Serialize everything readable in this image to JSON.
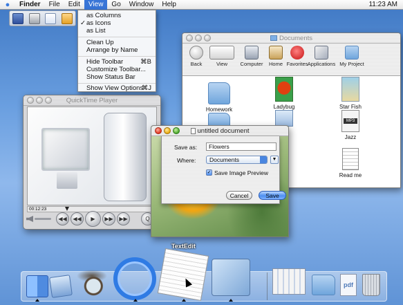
{
  "menubar": {
    "apple_icon": "apple-icon",
    "items": [
      "Finder",
      "File",
      "Edit",
      "View",
      "Go",
      "Window",
      "Help"
    ],
    "active": "View",
    "clock": "11:23 AM"
  },
  "view_menu": {
    "items": [
      {
        "label": "as Columns",
        "checked": false,
        "shortcut": ""
      },
      {
        "label": "as Icons",
        "checked": true,
        "shortcut": ""
      },
      {
        "label": "as List",
        "checked": false,
        "shortcut": ""
      },
      {
        "label": "Clean Up",
        "checked": false,
        "shortcut": ""
      },
      {
        "label": "Arrange by Name",
        "checked": false,
        "shortcut": ""
      },
      {
        "label": "Hide Toolbar",
        "checked": false,
        "shortcut": "⌘B"
      },
      {
        "label": "Customize Toolbar...",
        "checked": false,
        "shortcut": ""
      },
      {
        "label": "Show Status Bar",
        "checked": false,
        "shortcut": ""
      },
      {
        "label": "Show View Options",
        "checked": false,
        "shortcut": "⌘J"
      }
    ],
    "check_glyph": "✓"
  },
  "documents_window": {
    "title": "Documents",
    "toolbar": {
      "back": "Back",
      "view": "View",
      "computer": "Computer",
      "home": "Home",
      "favorites": "Favorites",
      "applications": "Applications",
      "my_project": "My Project"
    },
    "items": {
      "homework": "Homework",
      "ladybug": "Ladybug",
      "star_fish": "Star Fish",
      "jazz": "Jazz",
      "read_me": "Read me"
    },
    "badges": {
      "mp3": "MP3",
      "pdf": "pdf"
    }
  },
  "quicktime": {
    "title": "QuickTime Player",
    "time": "00:12:23"
  },
  "save_dialog": {
    "window_title": "untitled document",
    "save_as_label": "Save as:",
    "save_as_value": "Flowers",
    "where_label": "Where:",
    "where_value": "Documents",
    "checkbox_label": "Save Image Preview",
    "checkbox_checked": true,
    "cancel": "Cancel",
    "save": "Save"
  },
  "dock": {
    "label": "TextEdit",
    "items": [
      "finder",
      "mail",
      "sherlock",
      "internet-explorer",
      "textedit",
      "iphoto",
      "dock-minimized-window",
      "documents-folder",
      "pdf",
      "trash"
    ]
  },
  "colors": {
    "menu_highlight": "#3875d7",
    "desktop": "#5f93d6",
    "default_button": "#4e8ff0"
  }
}
